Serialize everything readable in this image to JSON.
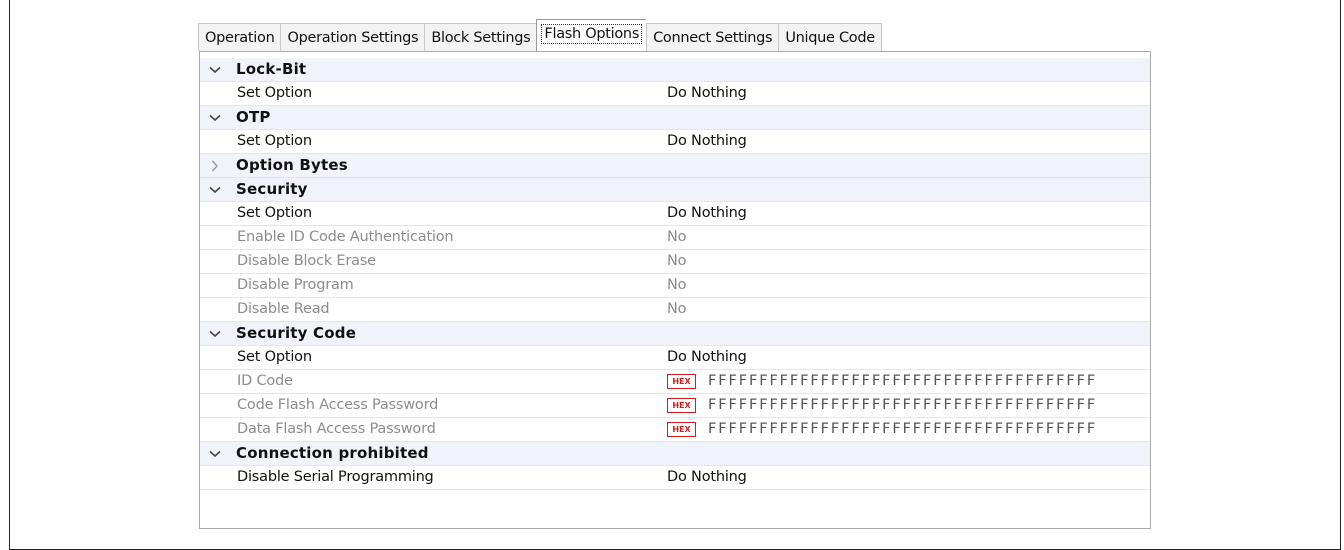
{
  "tabs": [
    {
      "label": "Operation",
      "active": false
    },
    {
      "label": "Operation Settings",
      "active": false
    },
    {
      "label": "Block Settings",
      "active": false
    },
    {
      "label": "Flash Options",
      "active": true
    },
    {
      "label": "Connect Settings",
      "active": false
    },
    {
      "label": "Unique Code",
      "active": false
    }
  ],
  "grid": {
    "lock_bit": {
      "label": "Lock-Bit",
      "expanded": true,
      "set_option": {
        "label": "Set Option",
        "value": "Do Nothing"
      }
    },
    "otp": {
      "label": "OTP",
      "expanded": true,
      "set_option": {
        "label": "Set Option",
        "value": "Do Nothing"
      }
    },
    "option_bytes": {
      "label": "Option Bytes",
      "expanded": false
    },
    "security": {
      "label": "Security",
      "expanded": true,
      "rows": [
        {
          "label": "Set Option",
          "value": "Do Nothing",
          "enabled": true
        },
        {
          "label": "Enable ID Code Authentication",
          "value": "No",
          "enabled": false
        },
        {
          "label": "Disable Block Erase",
          "value": "No",
          "enabled": false
        },
        {
          "label": "Disable Program",
          "value": "No",
          "enabled": false
        },
        {
          "label": "Disable Read",
          "value": "No",
          "enabled": false
        }
      ]
    },
    "security_code": {
      "label": "Security Code",
      "expanded": true,
      "set_option": {
        "label": "Set Option",
        "value": "Do Nothing"
      },
      "hex_badge": "HEX",
      "rows": [
        {
          "label": "ID Code",
          "value": "FFFFFFFFFFFFFFFFFFFFFFFFFFFFFFFFFFFFFF"
        },
        {
          "label": "Code Flash Access Password",
          "value": "FFFFFFFFFFFFFFFFFFFFFFFFFFFFFFFFFFFFFF"
        },
        {
          "label": "Data Flash Access Password",
          "value": "FFFFFFFFFFFFFFFFFFFFFFFFFFFFFFFFFFFFFF"
        }
      ]
    },
    "connection_prohibited": {
      "label": "Connection prohibited",
      "expanded": true,
      "disable_serial": {
        "label": "Disable Serial Programming",
        "value": "Do Nothing"
      }
    }
  },
  "icons": {
    "expanded": "chevron-down-icon",
    "collapsed": "chevron-right-icon"
  },
  "colors": {
    "category_bg": "#f0f3f9",
    "disabled_text": "#8c8c8c",
    "hex_badge": "#d21c1c"
  }
}
